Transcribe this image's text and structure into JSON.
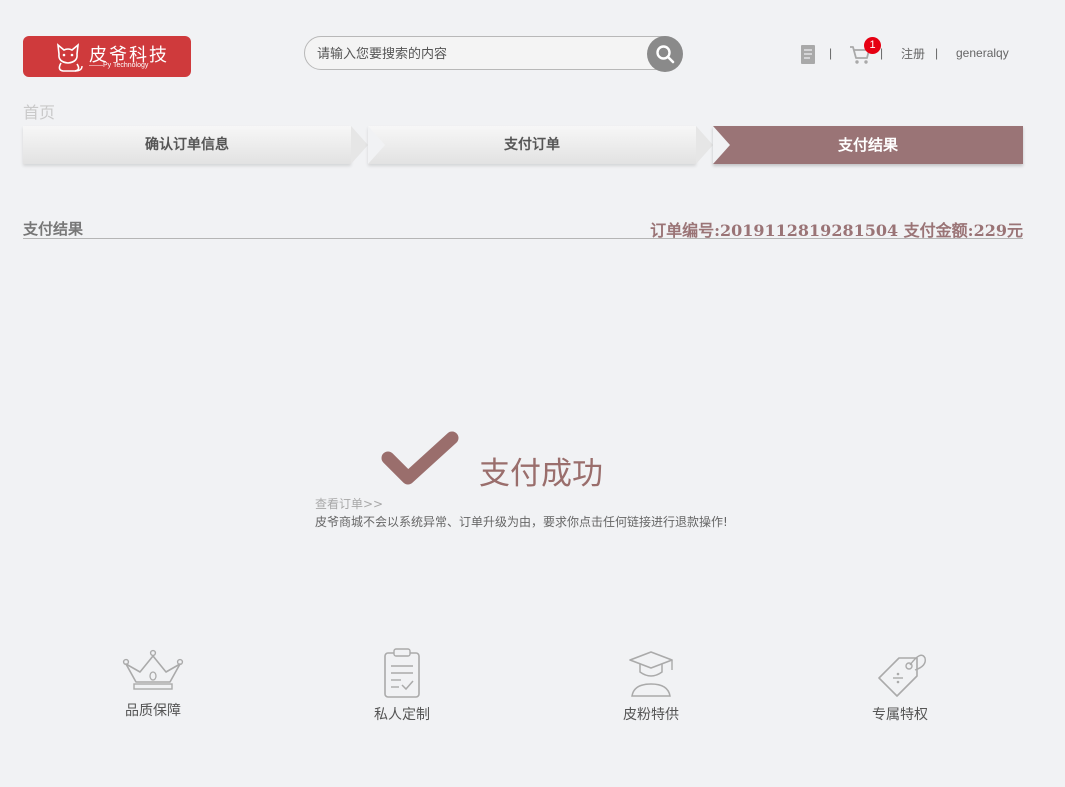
{
  "header": {
    "logo_text": "皮爷科技",
    "logo_subtext": "——Py Technology",
    "search_placeholder": "请输入您要搜索的内容",
    "separator": "|",
    "cart_count": "1",
    "register_label": "注册",
    "username": "generalqy"
  },
  "breadcrumb": {
    "home": "首页"
  },
  "steps": [
    {
      "label": "确认订单信息"
    },
    {
      "label": "支付订单"
    },
    {
      "label": "支付结果",
      "active": true
    }
  ],
  "result": {
    "title": "支付结果",
    "order_info": "订单编号:2019112819281504  支付金额:229元",
    "status_text": "支付成功",
    "view_order_link": "查看订单>>",
    "notice": "皮爷商城不会以系统异常、订单升级为由，要求你点击任何链接进行退款操作!"
  },
  "features": [
    {
      "icon": "crown-icon",
      "label": "品质保障"
    },
    {
      "icon": "clipboard-check-icon",
      "label": "私人定制"
    },
    {
      "icon": "graduate-icon",
      "label": "皮粉特供"
    },
    {
      "icon": "price-tag-icon",
      "label": "专属特权"
    }
  ],
  "colors": {
    "brand_red": "#cf3a3c",
    "accent": "#9a7476",
    "success": "#9a6e6c",
    "badge": "#e60012",
    "background": "#f1f2f4"
  }
}
